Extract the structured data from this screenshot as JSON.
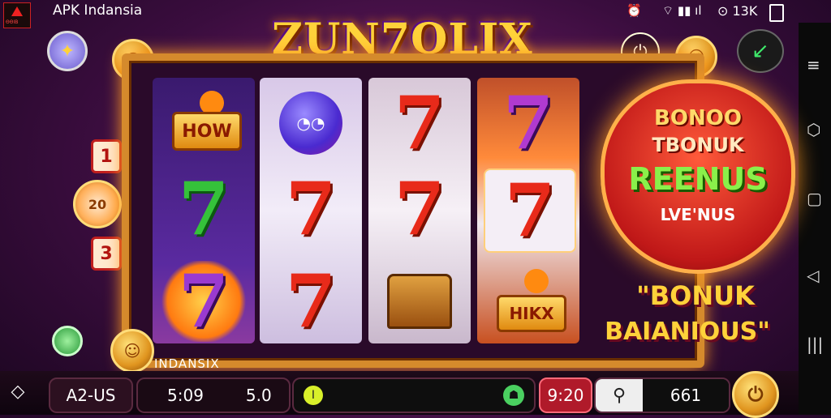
{
  "status_bar": {
    "app_name": "APK Indansia",
    "logo_text": "ΘΘΙΒ",
    "signal": "⌔ ▮▮ ıl",
    "time": "⊙ 13K"
  },
  "game": {
    "title": "ZUN7OLIX",
    "frame_caption": "INDANSIX"
  },
  "reels": [
    {
      "symbols": [
        "HOW",
        "7",
        "7"
      ]
    },
    {
      "symbols": [
        "blob",
        "7",
        "7"
      ]
    },
    {
      "symbols": [
        "7",
        "7",
        "chest"
      ]
    },
    {
      "symbols": [
        "7",
        "7",
        "HIKX"
      ]
    }
  ],
  "bonus_panel": {
    "line1": "BONOO",
    "line2": "TBONUK",
    "line3": "REENUS",
    "line4": "LVE'NUS",
    "line5": "\"BONUK",
    "line6": "BAIANIOUS\""
  },
  "left_side": {
    "num1": "1",
    "coin_label": "20",
    "num3": "3"
  },
  "bottom_bar": {
    "bet_label": "A2-US",
    "time_value": "5:09",
    "lines_value": "5.0",
    "ticket_value": "9:20",
    "balance_value": "661"
  },
  "colors": {
    "accent": "#ffd23a",
    "red": "#c01818",
    "frame": "#d58a2c"
  },
  "icons": [
    "diamond-icon",
    "search-icon",
    "clover-icon",
    "power-icon",
    "arrow-icon",
    "spin-icon",
    "back-nav-icon",
    "home-nav-icon",
    "recent-nav-icon",
    "menu-nav-icon"
  ]
}
